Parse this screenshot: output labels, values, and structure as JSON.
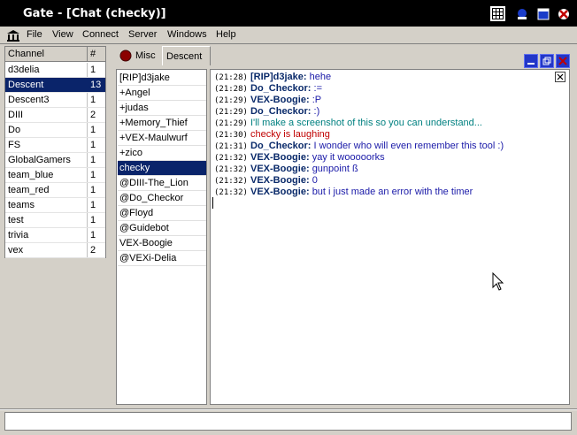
{
  "window": {
    "title": "Gate - [Chat (checky)]",
    "title_buttons": [
      "grid-icon",
      "minimize-icon",
      "maximize-icon",
      "close-icon"
    ]
  },
  "menu": {
    "items": [
      "File",
      "View",
      "Connect",
      "Server",
      "Windows",
      "Help"
    ]
  },
  "channels": {
    "header": {
      "name": "Channel",
      "count": "#"
    },
    "rows": [
      {
        "name": "d3delia",
        "count": "1"
      },
      {
        "name": "Descent",
        "count": "13",
        "selected": true
      },
      {
        "name": "Descent3",
        "count": "1"
      },
      {
        "name": "DIII",
        "count": "2"
      },
      {
        "name": "Do",
        "count": "1"
      },
      {
        "name": "FS",
        "count": "1"
      },
      {
        "name": "GlobalGamers",
        "count": "1"
      },
      {
        "name": "team_blue",
        "count": "1"
      },
      {
        "name": "team_red",
        "count": "1"
      },
      {
        "name": "teams",
        "count": "1"
      },
      {
        "name": "test",
        "count": "1"
      },
      {
        "name": "trivia",
        "count": "1"
      },
      {
        "name": "vex",
        "count": "2"
      }
    ]
  },
  "tabs": [
    {
      "label": "Misc",
      "active": false
    },
    {
      "label": "Descent",
      "active": true
    }
  ],
  "users": [
    {
      "name": "[RIP]d3jake"
    },
    {
      "name": "+Angel"
    },
    {
      "name": "+judas"
    },
    {
      "name": "+Memory_Thief"
    },
    {
      "name": "+VEX-Maulwurf"
    },
    {
      "name": "+zico"
    },
    {
      "name": "checky",
      "selected": true
    },
    {
      "name": "@DIII-The_Lion"
    },
    {
      "name": "@Do_Checkor"
    },
    {
      "name": "@Floyd"
    },
    {
      "name": "@Guidebot"
    },
    {
      "name": "VEX-Boogie"
    },
    {
      "name": "@VEXi-Delia"
    }
  ],
  "chat": {
    "lines": [
      {
        "time": "(21:28)",
        "nick": "[RIP]d3jake:",
        "text": "hehe",
        "kind": "msg"
      },
      {
        "time": "(21:28)",
        "nick": "Do_Checkor:",
        "text": ":=",
        "kind": "msg"
      },
      {
        "time": "(21:29)",
        "nick": "VEX-Boogie:",
        "text": ":P",
        "kind": "msg"
      },
      {
        "time": "(21:29)",
        "nick": "Do_Checkor:",
        "text": ":)",
        "kind": "msg"
      },
      {
        "time": "(21:29)",
        "nick": "",
        "text": "I'll make a screenshot of this so you can understand...",
        "kind": "action"
      },
      {
        "time": "(21:30)",
        "nick": "",
        "text": "checky is laughing",
        "kind": "self"
      },
      {
        "time": "(21:31)",
        "nick": "Do_Checkor:",
        "text": "I wonder who will even remember this tool :)",
        "kind": "msg"
      },
      {
        "time": "(21:32)",
        "nick": "VEX-Boogie:",
        "text": "yay it wooooorks",
        "kind": "msg"
      },
      {
        "time": "(21:32)",
        "nick": "VEX-Boogie:",
        "text": "gunpoint ß",
        "kind": "msg"
      },
      {
        "time": "(21:32)",
        "nick": "VEX-Boogie:",
        "text": "0",
        "kind": "msg"
      },
      {
        "time": "(21:32)",
        "nick": "VEX-Boogie:",
        "text": "but i just made an error with the timer",
        "kind": "msg"
      }
    ]
  },
  "input": {
    "value": ""
  },
  "colors": {
    "selection": "#0a246a",
    "nick": "#0a2a6a",
    "message": "#1a1aa8",
    "action": "#008080",
    "self": "#c00000"
  }
}
